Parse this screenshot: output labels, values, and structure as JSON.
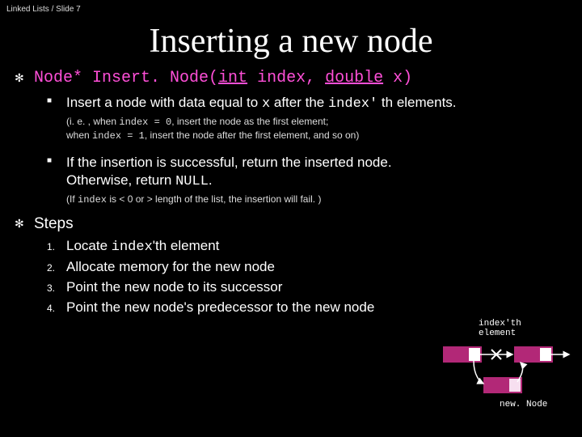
{
  "breadcrumb": "Linked Lists / Slide 7",
  "title": "Inserting a new node",
  "signature": {
    "pre": "Node* Insert. Node(",
    "kw1": "int",
    "mid1": " index, ",
    "kw2": "double",
    "post": " x)"
  },
  "bullets": {
    "b1": {
      "t1": "Insert a node with data equal to ",
      "code1": "x",
      "t2": " after the ",
      "code2": "index'",
      "t3": " th   elements."
    },
    "note1": {
      "t1": "(i. e. , when ",
      "c1": "index = 0",
      "t2": ", insert the node as the first element;",
      "t3": "when ",
      "c2": "index = 1",
      "t4": ", insert the node after the first element, and so on)"
    },
    "b2": {
      "t1": "If the insertion is successful, return the inserted node.",
      "t2": " Otherwise, return ",
      "c1": "NULL",
      "t3": "."
    },
    "note2": {
      "t1": "(If ",
      "c1": "index",
      "t2": " is < 0 or > length of the list, the insertion will fail. )"
    }
  },
  "steps": {
    "header": "Steps",
    "items": [
      {
        "num": "1.",
        "t1": "Locate ",
        "c1": "index",
        "t2": "'th element"
      },
      {
        "num": "2.",
        "t1": "Allocate memory for the new node",
        "c1": "",
        "t2": ""
      },
      {
        "num": "3.",
        "t1": "Point the new node to its successor",
        "c1": "",
        "t2": ""
      },
      {
        "num": "4.",
        "t1": "Point the new node's predecessor to the new node",
        "c1": "",
        "t2": ""
      }
    ]
  },
  "diagram": {
    "label_top": "index'th\nelement",
    "label_bottom": "new. Node"
  }
}
